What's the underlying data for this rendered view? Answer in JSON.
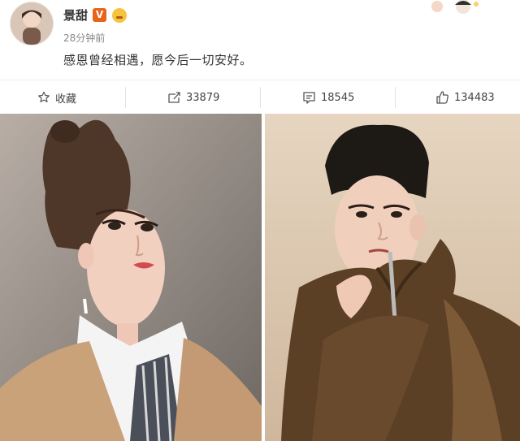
{
  "post": {
    "username": "景甜",
    "verify_label": "V",
    "timestamp": "28分钟前",
    "text": "感恩曾经相遇，愿今后一切安好。"
  },
  "actions": {
    "favorite_label": "收藏",
    "repost_count": "33879",
    "comment_count": "18545",
    "like_count": "134483"
  },
  "icons": [
    "avatar",
    "verified-icon",
    "emoji-icon",
    "star-icon",
    "repost-icon",
    "comment-icon",
    "like-icon"
  ],
  "colors": {
    "badge": "#e8641b",
    "text": "#333333",
    "muted": "#888888",
    "divider": "#e2e2e2"
  }
}
